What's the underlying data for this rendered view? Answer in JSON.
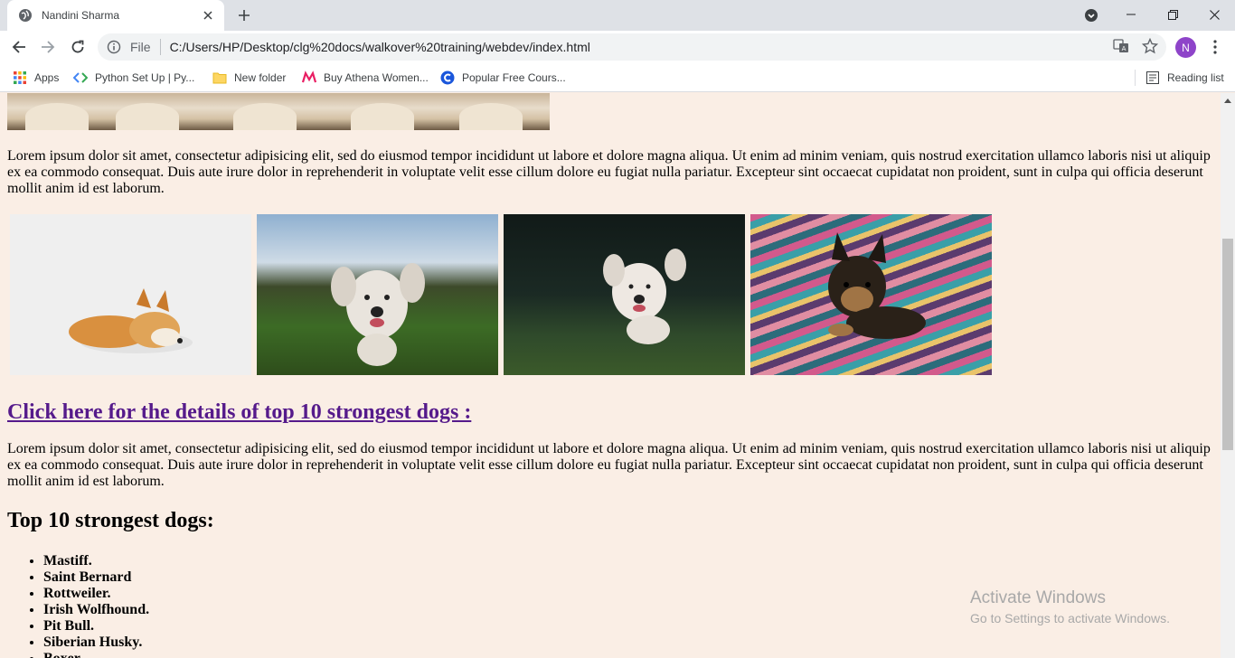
{
  "browser": {
    "tab_title": "Nandini Sharma",
    "url_scheme": "File",
    "url": "C:/Users/HP/Desktop/clg%20docs/walkover%20training/webdev/index.html",
    "profile_initial": "N"
  },
  "bookmarks": {
    "items": [
      {
        "label": "Apps",
        "icon": "apps-grid-icon"
      },
      {
        "label": "Python Set Up  |  Py...",
        "icon": "code-icon"
      },
      {
        "label": "New folder",
        "icon": "folder-icon"
      },
      {
        "label": "Buy Athena Women...",
        "icon": "myntra-icon"
      },
      {
        "label": "Popular Free Cours...",
        "icon": "course-icon"
      }
    ],
    "reading_list": "Reading list"
  },
  "page": {
    "lorem": "Lorem ipsum dolor sit amet, consectetur adipisicing elit, sed do eiusmod tempor incididunt ut labore et dolore magna aliqua. Ut enim ad minim veniam, quis nostrud exercitation ullamco laboris nisi ut aliquip ex ea commodo consequat. Duis aute irure dolor in reprehenderit in voluptate velit esse cillum dolore eu fugiat nulla pariatur. Excepteur sint occaecat cupidatat non proident, sunt in culpa qui officia deserunt mollit anim id est laborum.",
    "link_text": "Click here for the details of top 10 strongest dogs :",
    "heading": "Top 10 strongest dogs:",
    "dogs": [
      "Mastiff.",
      "Saint Bernard",
      "Rottweiler.",
      "Irish Wolfhound.",
      "Pit Bull.",
      "Siberian Husky.",
      "Boxer."
    ]
  },
  "watermark": {
    "line1": "Activate Windows",
    "line2": "Go to Settings to activate Windows."
  }
}
